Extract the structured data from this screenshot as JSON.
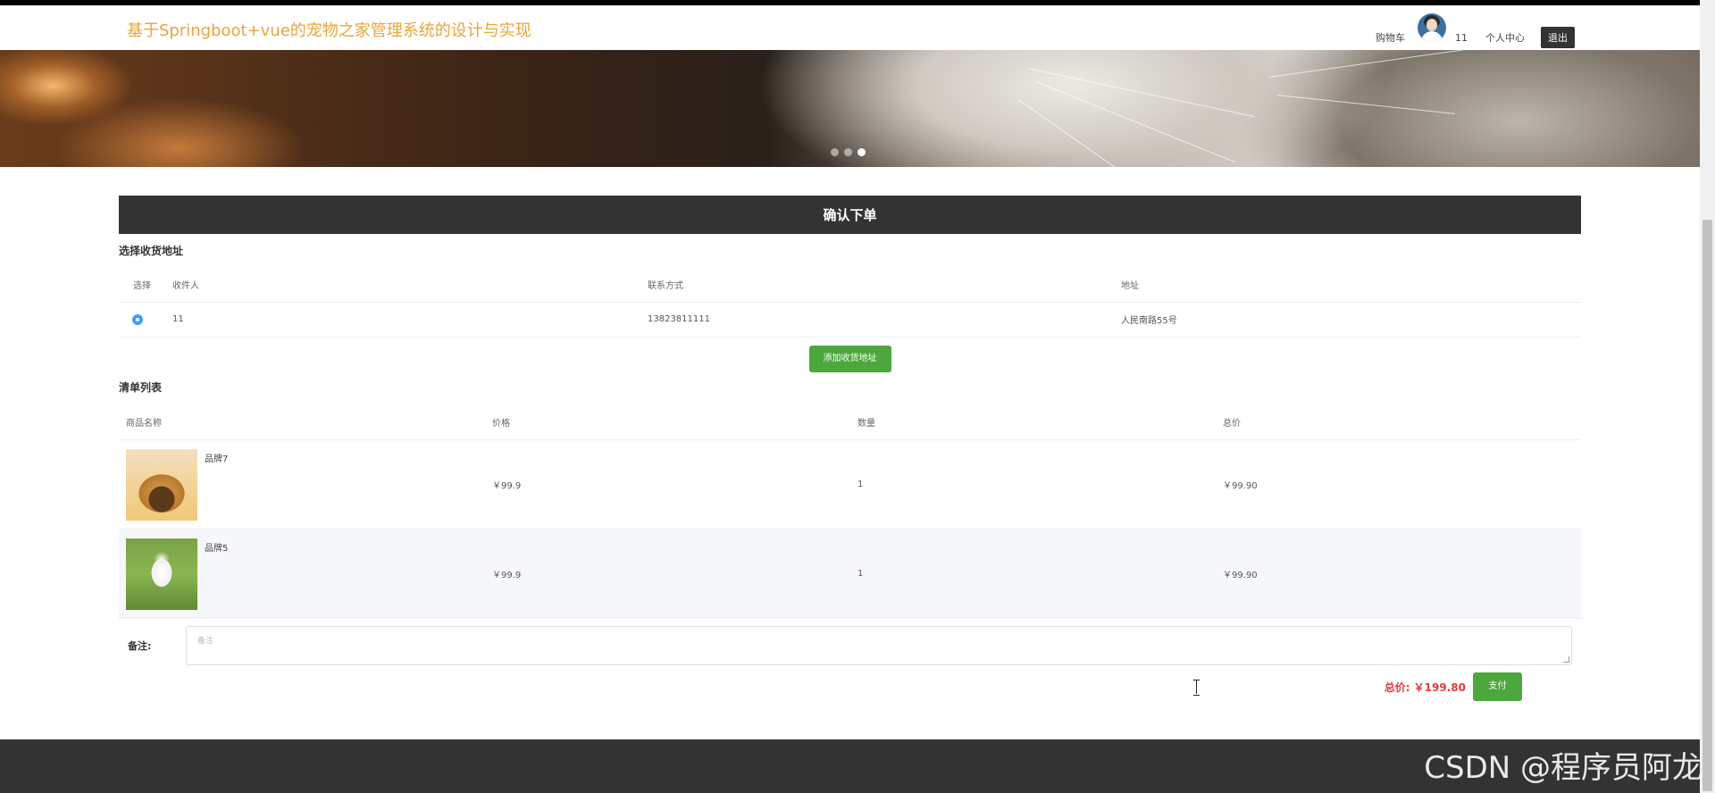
{
  "header": {
    "site_title": "基于Springboot+vue的宠物之家管理系统的设计与实现",
    "cart_label": "购物车",
    "username": "11",
    "user_center_label": "个人中心",
    "logout_label": "退出"
  },
  "banner": {
    "slide_count": 3,
    "active_slide": 3
  },
  "order": {
    "confirm_title": "确认下单",
    "address_section_title": "选择收货地址",
    "address_columns": [
      "选择",
      "收件人",
      "联系方式",
      "地址"
    ],
    "addresses": [
      {
        "selected": true,
        "recipient": "11",
        "phone": "13823811111",
        "address": "人民南路55号"
      }
    ],
    "add_address_label": "添加收货地址",
    "list_section_title": "清单列表",
    "item_columns": [
      "商品名称",
      "价格",
      "数量",
      "总价"
    ],
    "items": [
      {
        "name": "品牌7",
        "price": "￥99.9",
        "quantity": "1",
        "total": "￥99.90"
      },
      {
        "name": "品牌5",
        "price": "￥99.9",
        "quantity": "1",
        "total": "￥99.90"
      }
    ],
    "remark_label": "备注:",
    "remark_placeholder": "备注",
    "total_label": "总价: ￥199.80",
    "pay_label": "支付"
  },
  "watermark": "CSDN @程序员阿龙",
  "colors": {
    "accent_title": "#e8a53a",
    "dark_bar": "#333333",
    "green_button": "#4ca83c",
    "total_red": "#e4393c",
    "radio_blue": "#409eff"
  }
}
